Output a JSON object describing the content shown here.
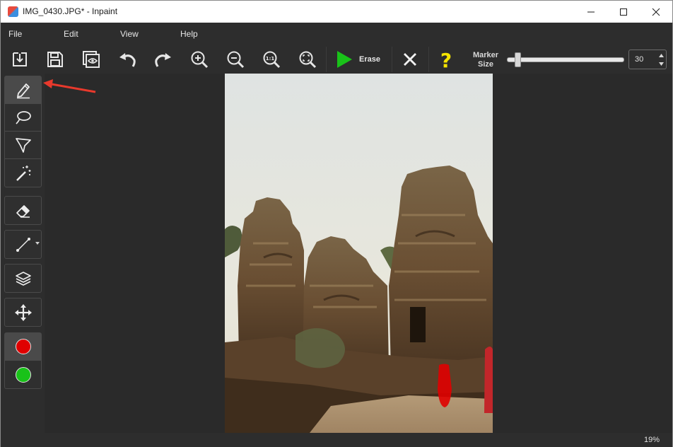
{
  "window": {
    "title": "IMG_0430.JPG* - Inpaint"
  },
  "menu": {
    "items": [
      {
        "label": "File"
      },
      {
        "label": "Edit"
      },
      {
        "label": "View"
      },
      {
        "label": "Help"
      }
    ]
  },
  "toolbar": {
    "erase_label": "Erase",
    "marker_size_label_line1": "Marker",
    "marker_size_label_line2": "Size",
    "marker_size_value": "30",
    "marker_size_fraction": 0.05
  },
  "tools": {
    "selection": [
      "marker-tool",
      "lasso-tool",
      "polygonal-lasso-tool",
      "magic-wand-tool"
    ],
    "active": "marker-tool"
  },
  "colors": {
    "accent_green": "#19c219",
    "help_yellow": "#f5e400",
    "mask_red": "#e00000",
    "keep_green": "#19c219",
    "annotation_red": "#e8392c"
  },
  "status": {
    "zoom": "19%"
  }
}
